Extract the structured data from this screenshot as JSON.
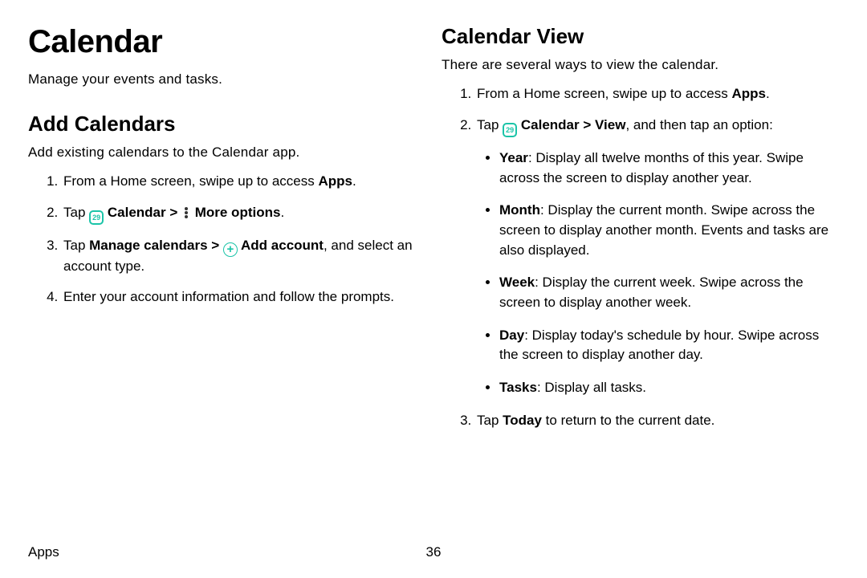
{
  "left": {
    "title": "Calendar",
    "subtitle": "Manage your events and tasks.",
    "section_title": "Add Calendars",
    "section_desc": "Add existing calendars to the Calendar app.",
    "step1_a": "From a Home screen, swipe up to access ",
    "step1_b": "Apps",
    "step1_c": ".",
    "step2_a": "Tap ",
    "step2_cal": " Calendar",
    "step2_gt": " > ",
    "step2_more": " More options",
    "step2_end": ".",
    "step3_a": "Tap ",
    "step3_b": "Manage calendars",
    "step3_gt": " > ",
    "step3_add": " Add account",
    "step3_c": ", and select an account type.",
    "step4": "Enter your account information and follow the prompts.",
    "icon_cal_text": "29"
  },
  "right": {
    "section_title": "Calendar View",
    "section_desc": "There are several ways to view the calendar.",
    "step1_a": "From a Home screen, swipe up to access ",
    "step1_b": "Apps",
    "step1_c": ".",
    "step2_a": "Tap ",
    "step2_cal": " Calendar",
    "step2_gt": " > ",
    "step2_view": "View",
    "step2_end": ", and then tap an option:",
    "bullets": {
      "year_b": "Year",
      "year_t": ": Display all twelve months of this year. Swipe across the screen to display another year.",
      "month_b": "Month",
      "month_t": ": Display the current month. Swipe across the screen to display another month. Events and tasks are also displayed.",
      "week_b": "Week",
      "week_t": ": Display the current week. Swipe across the screen to display another week.",
      "day_b": "Day",
      "day_t": ": Display today's schedule by hour. Swipe across the screen to display another day.",
      "tasks_b": "Tasks",
      "tasks_t": ": Display all tasks."
    },
    "step3_a": "Tap ",
    "step3_b": "Today",
    "step3_c": " to return to the current date.",
    "icon_cal_text": "29"
  },
  "footer": {
    "section": "Apps",
    "page": "36"
  }
}
